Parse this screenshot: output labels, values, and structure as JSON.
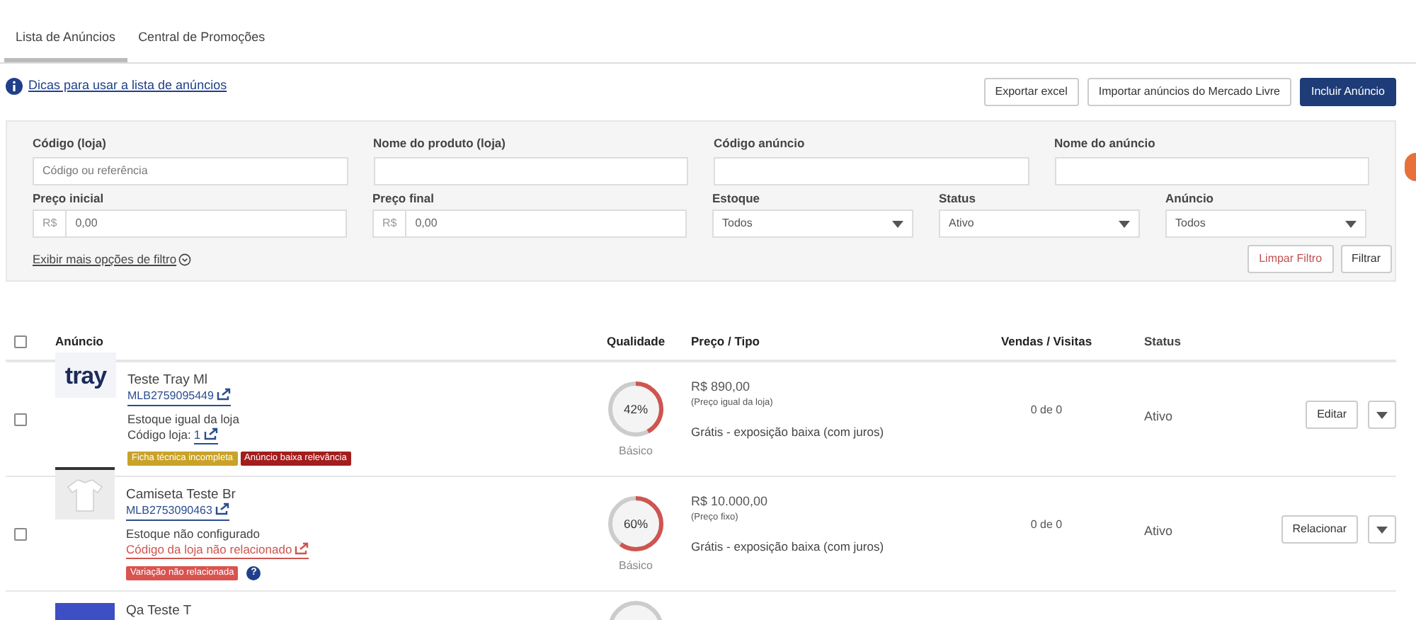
{
  "tabs": [
    {
      "label": "Lista de Anúncios",
      "selected": true
    },
    {
      "label": "Central de Promoções",
      "selected": false
    }
  ],
  "help_link": "Dicas para usar a lista de anúncios",
  "toolbar_buttons": [
    {
      "label": "Exportar excel",
      "kind": "secondary"
    },
    {
      "label": "Importar anúncios do Mercado Livre",
      "kind": "secondary"
    },
    {
      "label": "Incluir Anúncio",
      "kind": "primary"
    }
  ],
  "filters": {
    "row1": [
      {
        "label": "Código (loja)",
        "placeholder": "Código ou referência"
      },
      {
        "label": "Nome do produto (loja)"
      },
      {
        "label": "Código anúncio"
      },
      {
        "label": "Nome do anúncio"
      }
    ],
    "row2": [
      {
        "kind": "money",
        "label": "Preço inicial",
        "prefix": "R$",
        "value": "0,00"
      },
      {
        "kind": "money",
        "label": "Preço final",
        "prefix": "R$",
        "value": "0,00"
      },
      {
        "kind": "select",
        "label": "Estoque",
        "value": "Todos"
      },
      {
        "kind": "select",
        "label": "Status",
        "value": "Ativo"
      },
      {
        "kind": "select",
        "label": "Anúncio",
        "value": "Todos"
      }
    ],
    "more_link": "Exibir mais opções de filtro",
    "clear_button": "Limpar Filtro",
    "filter_button": "Filtrar"
  },
  "table": {
    "select_all": {
      "checked": false
    },
    "columns": [
      "Anúncio",
      "Qualidade",
      "Preço / Tipo",
      "Vendas / Visitas",
      "Status"
    ],
    "rows": [
      {
        "checked": false,
        "logo": "tray",
        "title": "Teste Tray Ml",
        "code": "MLB2759095449",
        "stock": "Estoque igual da loja",
        "store_code_label": "Código loja:",
        "store_code": "1",
        "tags": [
          {
            "text": "Ficha técnica incompleta",
            "color": "#c9a227"
          },
          {
            "text": "Anúncio baixa relevância",
            "color": "#a31d1d"
          }
        ],
        "quality": {
          "level": 0.42,
          "reading": "42%",
          "label": "Básico"
        },
        "price": "R$ 890,00",
        "price_note": "(Preço igual da loja)",
        "type": "Grátis - exposição baixa (com juros)",
        "sales": "0 de 0",
        "status": "Ativo",
        "action": "Editar"
      },
      {
        "checked": false,
        "title": "Camiseta Teste Br",
        "code": "MLB2753090463",
        "stock": "Estoque não configurado",
        "store_code_label": "Código da loja não relacionado",
        "tags": [
          {
            "text": "Variação não relacionada",
            "color": "#d9534f"
          }
        ],
        "tag_help": "?",
        "quality": {
          "level": 0.6,
          "reading": "60%",
          "label": "Básico"
        },
        "price": "R$ 10.000,00",
        "price_note": "(Preço fixo)",
        "type": "Grátis - exposição baixa (com juros)",
        "sales": "0 de 0",
        "status": "Ativo",
        "action": "Relacionar"
      },
      {
        "title": "Qa Teste T"
      }
    ]
  }
}
